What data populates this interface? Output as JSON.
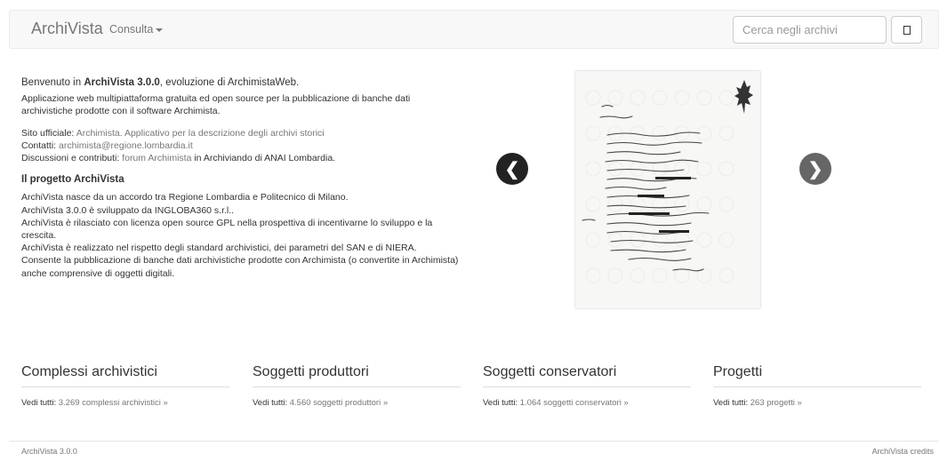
{
  "navbar": {
    "brand": "ArchiVista",
    "menu_label": "Consulta",
    "search_placeholder": "Cerca negli archivi"
  },
  "intro": {
    "welcome_prefix": "Benvenuto in ",
    "welcome_name": "ArchiVista 3.0.0",
    "welcome_suffix": ", evoluzione di ArchimistaWeb.",
    "description": "Applicazione web multipiattaforma gratuita ed open source per la pubblicazione di banche dati archivistiche prodotte con il software Archimista.",
    "site_label": "Sito ufficiale:",
    "site_link": "Archimista. Applicativo per la descrizione degli archivi storici",
    "contacts_label": "Contatti:",
    "contacts_email": "archimista@regione.lombardia.it",
    "discussion_label": "Discussioni e contributi:",
    "discussion_link": "forum Archimista",
    "discussion_suffix": "in Archiviando di ANAI Lombardia."
  },
  "project": {
    "heading": "Il progetto ArchiVista",
    "lines": [
      "ArchiVista nasce da un accordo tra Regione Lombardia e Politecnico di Milano.",
      "ArchiVista 3.0.0 è sviluppato da INGLOBA360 s.r.l..",
      "ArchiVista è rilasciato con licenza open source GPL nella prospettiva di incentivarne lo sviluppo e la crescita.",
      "ArchiVista è realizzato nel rispetto degli standard archivistici, dei parametri del SAN e di NIERA.",
      "Consente la pubblicazione di banche dati archivistiche prodotte con Archimista (o convertite in Archimista) anche comprensive di oggetti digitali."
    ]
  },
  "carousel": {
    "prev_icon": "chevron-left-icon",
    "next_icon": "chevron-right-icon",
    "prev_glyph": "❮",
    "next_glyph": "❯"
  },
  "sections": [
    {
      "title": "Complessi archivistici",
      "label": "Vedi tutti:",
      "link": "3.269 complessi archivistici »"
    },
    {
      "title": "Soggetti produttori",
      "label": "Vedi tutti:",
      "link": "4.560 soggetti produttori »"
    },
    {
      "title": "Soggetti conservatori",
      "label": "Vedi tutti:",
      "link": "1.064 soggetti conservatori »"
    },
    {
      "title": "Progetti",
      "label": "Vedi tutti:",
      "link": "263 progetti »"
    }
  ],
  "footer": {
    "left": "ArchiVista 3.0.0",
    "right": "ArchiVista credits"
  }
}
